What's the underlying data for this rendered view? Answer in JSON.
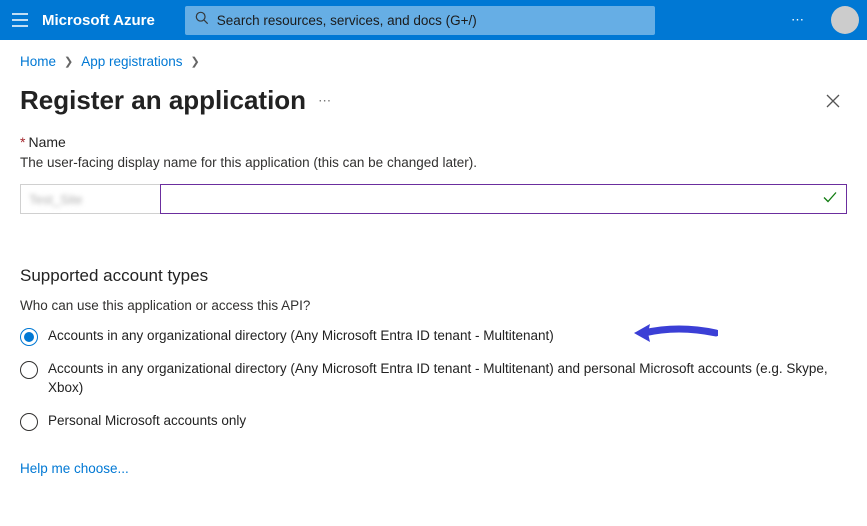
{
  "topbar": {
    "brand": "Microsoft Azure",
    "search_placeholder": "Search resources, services, and docs (G+/)",
    "more": "⋯"
  },
  "breadcrumb": {
    "home": "Home",
    "appreg": "App registrations"
  },
  "page": {
    "title": "Register an application",
    "more": "⋯"
  },
  "name_field": {
    "label": "Name",
    "description": "The user-facing display name for this application (this can be changed later).",
    "value": "Test_Site"
  },
  "account_types": {
    "title": "Supported account types",
    "subtitle": "Who can use this application or access this API?",
    "options": [
      "Accounts in any organizational directory (Any Microsoft Entra ID tenant - Multitenant)",
      "Accounts in any organizational directory (Any Microsoft Entra ID tenant - Multitenant) and personal Microsoft accounts (e.g. Skype, Xbox)",
      "Personal Microsoft accounts only"
    ]
  },
  "help_link": "Help me choose..."
}
